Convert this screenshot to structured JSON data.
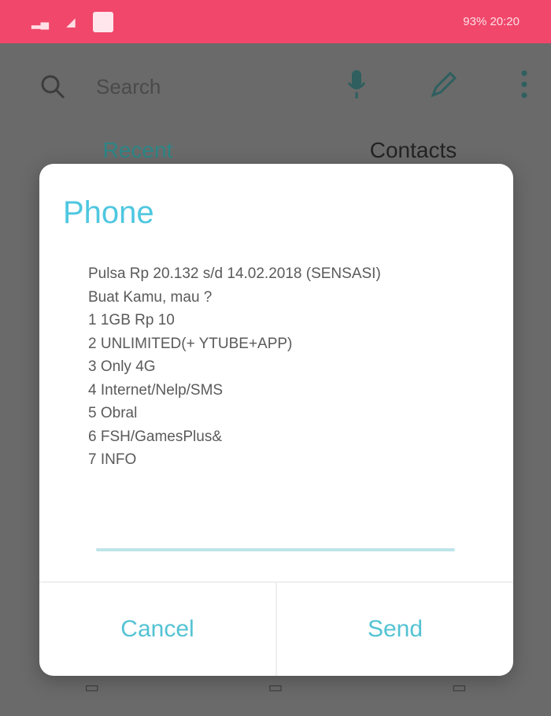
{
  "status_bar": {
    "left_text": "",
    "right_text": "93% 20:20"
  },
  "background": {
    "search_placeholder": "Search",
    "tabs": [
      "Recent",
      "Contacts"
    ]
  },
  "dialog": {
    "title": "Phone",
    "message_lines": [
      "Pulsa Rp 20.132 s/d 14.02.2018 (SENSASI)",
      "Buat Kamu, mau ?",
      "1 1GB Rp 10",
      "2 UNLIMITED(+ YTUBE+APP)",
      "3 Only 4G",
      "4 Internet/Nelp/SMS",
      "5 Obral",
      "6 FSH/GamesPlus&",
      "7 INFO"
    ],
    "cancel_label": "Cancel",
    "send_label": "Send"
  },
  "colors": {
    "status_bar": "#f0476b",
    "accent": "#4ec7e0",
    "scrim": "#6a6a6a"
  }
}
